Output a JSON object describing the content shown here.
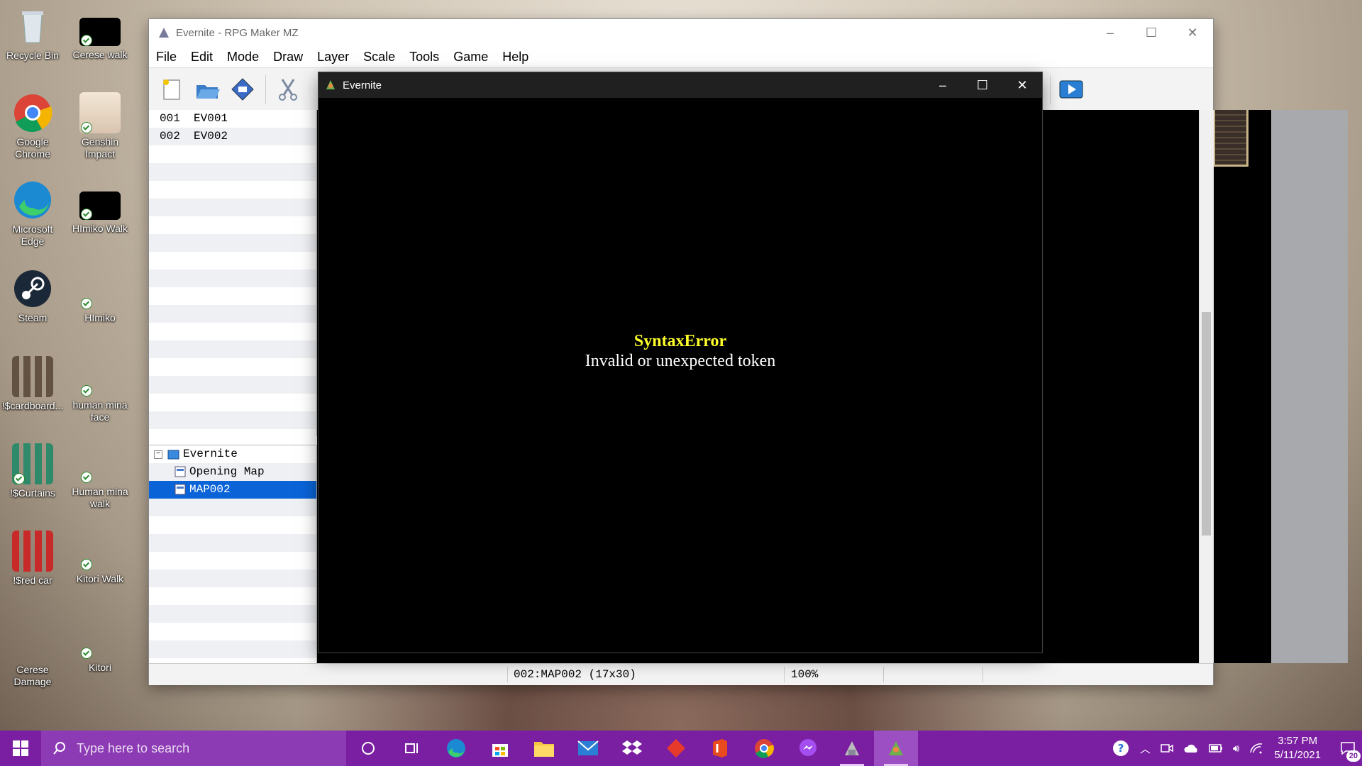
{
  "desktop": {
    "icons": [
      {
        "label": "Recycle Bin"
      },
      {
        "label": "Cerese walk"
      },
      {
        "label": "Google Chrome"
      },
      {
        "label": "Genshin Impact"
      },
      {
        "label": "Microsoft Edge"
      },
      {
        "label": "HImiko Walk"
      },
      {
        "label": "Steam"
      },
      {
        "label": "HImiko"
      },
      {
        "label": "!$cardboard..."
      },
      {
        "label": "human mina face"
      },
      {
        "label": "!$Curtains"
      },
      {
        "label": "Human mina walk"
      },
      {
        "label": "!$red car"
      },
      {
        "label": "Kitori Walk"
      },
      {
        "label": "Cerese Damage"
      },
      {
        "label": "Kitori"
      }
    ]
  },
  "rpg_window": {
    "title": "Evernite - RPG Maker MZ",
    "menu": [
      "File",
      "Edit",
      "Mode",
      "Draw",
      "Layer",
      "Scale",
      "Tools",
      "Game",
      "Help"
    ],
    "events": [
      {
        "id": "001",
        "name": "EV001"
      },
      {
        "id": "002",
        "name": "EV002"
      }
    ],
    "maps": {
      "root": "Evernite",
      "items": [
        "Opening Map",
        "MAP002"
      ],
      "selected": "MAP002"
    },
    "status": {
      "map": "002:MAP002 (17x30)",
      "zoom": "100%"
    }
  },
  "game_window": {
    "title": "Evernite",
    "error_title": "SyntaxError",
    "error_message": "Invalid or unexpected token"
  },
  "taskbar": {
    "search_placeholder": "Type here to search",
    "time": "3:57 PM",
    "date": "5/11/2021",
    "notifications": "20"
  },
  "colors": {
    "taskbar": "#7a1fa2",
    "selection": "#0a64d8",
    "error_title": "#ffff2a"
  }
}
